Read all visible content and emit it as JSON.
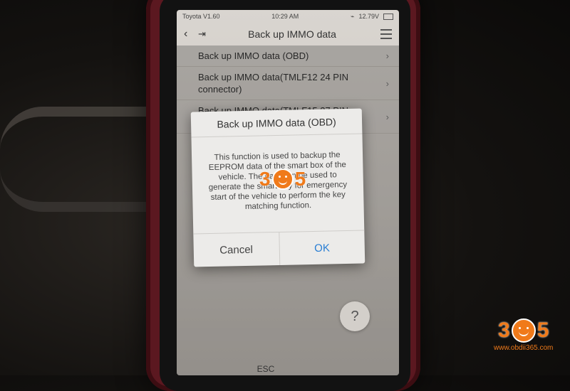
{
  "statusbar": {
    "app_version": "Toyota V1.60",
    "time": "10:29 AM",
    "voltage": "12.79V"
  },
  "appbar": {
    "title": "Back up IMMO data",
    "icons": [
      "back-arrow-icon",
      "exit-icon",
      "menu-icon"
    ]
  },
  "list": {
    "items": [
      {
        "label": "Back up IMMO data (OBD)"
      },
      {
        "label": "Back up IMMO data(TMLF12 24 PIN connector)"
      },
      {
        "label": "Back up IMMO data(TMLF15 27 PIN connector)"
      }
    ]
  },
  "dialog": {
    "title": "Back up IMMO data (OBD)",
    "body": "This function is used to backup the EEPROM data of the smart box of the vehicle. The data can be used to generate the smart key for emergency start of the vehicle to perform the key matching function.",
    "cancel_label": "Cancel",
    "ok_label": "OK"
  },
  "help_label": "?",
  "esc_label": "ESC",
  "watermark": {
    "digit_left": "3",
    "digit_right": "5",
    "site": "www.obdii365.com"
  },
  "colors": {
    "accent": "#2a7fd4",
    "watermark": "#f07a1a",
    "case": "#5b1820"
  }
}
